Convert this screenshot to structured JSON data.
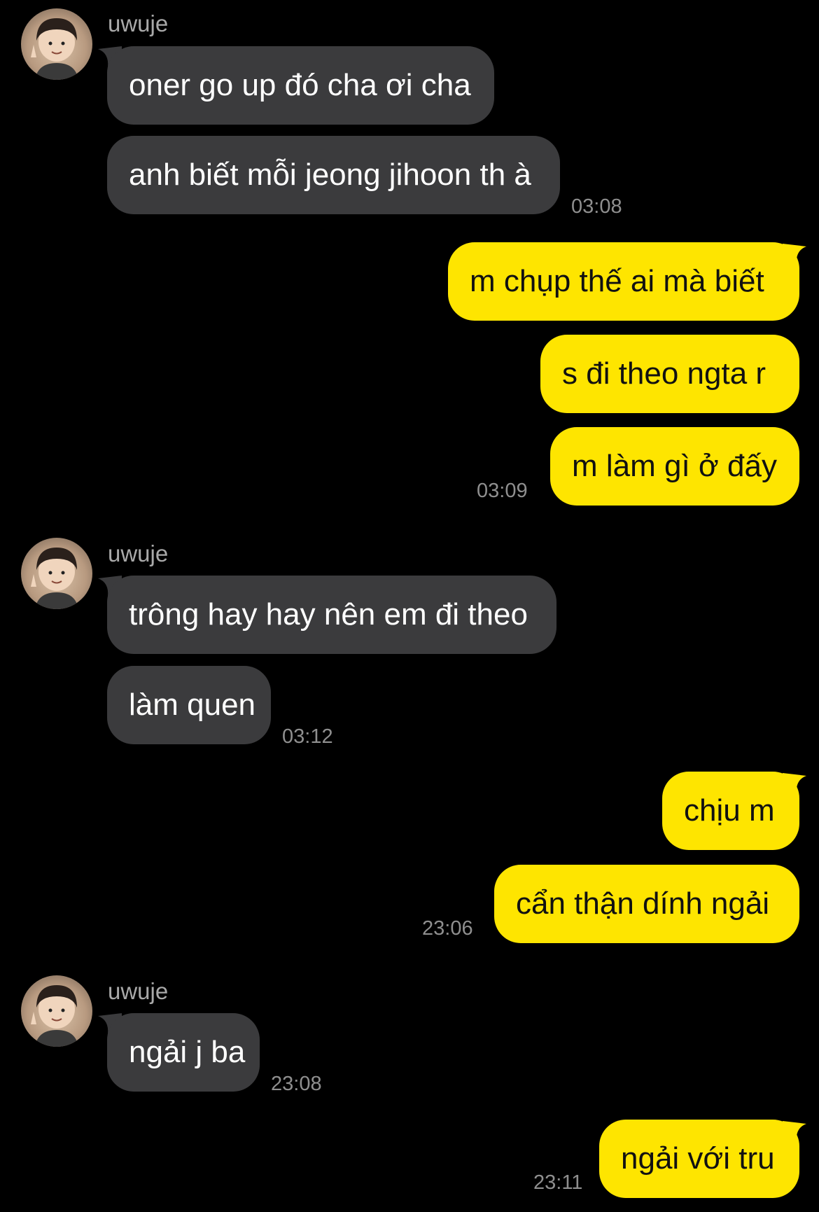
{
  "colors": {
    "background": "#000000",
    "incoming_bubble": "#3b3b3d",
    "outgoing_bubble": "#fee500",
    "timestamp": "#8f8f8f",
    "sender_name": "#a9a9a9"
  },
  "groups": [
    {
      "sender": "uwuje",
      "avatar_icon": "profile-avatar",
      "messages": [
        "oner go up đó cha ơi cha",
        "anh biết mỗi jeong jihoon th à"
      ],
      "time": "03:08"
    },
    {
      "sender": "me",
      "messages": [
        "m chụp thế ai mà biết",
        "s đi theo ngta r",
        "m làm gì ở đấy"
      ],
      "time": "03:09"
    },
    {
      "sender": "uwuje",
      "avatar_icon": "profile-avatar",
      "messages": [
        "trông hay hay nên em đi theo",
        "làm quen"
      ],
      "time": "03:12"
    },
    {
      "sender": "me",
      "messages": [
        "chịu m",
        "cẩn thận dính ngải"
      ],
      "time": "23:06"
    },
    {
      "sender": "uwuje",
      "avatar_icon": "profile-avatar",
      "messages": [
        "ngải j ba"
      ],
      "time": "23:08"
    },
    {
      "sender": "me",
      "messages": [
        "ngải với tru"
      ],
      "time": "23:11"
    }
  ]
}
